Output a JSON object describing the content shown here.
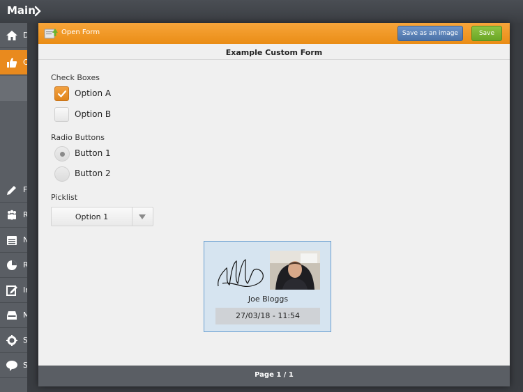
{
  "app": {
    "title": "Main"
  },
  "sidebar": {
    "items": [
      {
        "icon": "home-icon",
        "letter": "D",
        "active": false
      },
      {
        "icon": "thumbs-up-icon",
        "letter": "C",
        "active": true
      },
      {
        "icon": "pencil-icon",
        "letter": "F"
      },
      {
        "icon": "people-icon",
        "letter": "R"
      },
      {
        "icon": "calendar-icon",
        "letter": "N"
      },
      {
        "icon": "pie-chart-icon",
        "letter": "R"
      },
      {
        "icon": "edit-icon",
        "letter": "In"
      },
      {
        "icon": "inbox-icon",
        "letter": "M"
      },
      {
        "icon": "gear-icon",
        "letter": "S"
      },
      {
        "icon": "chat-bubble-icon",
        "letter": "S"
      }
    ]
  },
  "modal": {
    "header_title": "Open Form",
    "save_image_label": "Save as an image",
    "save_label": "Save",
    "form_title": "Example Custom Form",
    "checkboxes": {
      "label": "Check Boxes",
      "options": [
        {
          "label": "Option A",
          "checked": true
        },
        {
          "label": "Option B",
          "checked": false
        }
      ]
    },
    "radios": {
      "label": "Radio Buttons",
      "options": [
        {
          "label": "Button 1",
          "selected": true
        },
        {
          "label": "Button 2",
          "selected": false
        }
      ]
    },
    "picklist": {
      "label": "Picklist",
      "value": "Option 1"
    },
    "signature": {
      "name": "Joe Bloggs",
      "timestamp": "27/03/18 - 11:54"
    },
    "footer_page": "Page 1 / 1"
  },
  "colors": {
    "accent": "#ea8d16",
    "save_green": "#6aa626",
    "save_image_blue": "#4c73a8",
    "card_border": "#6a9fd0"
  }
}
